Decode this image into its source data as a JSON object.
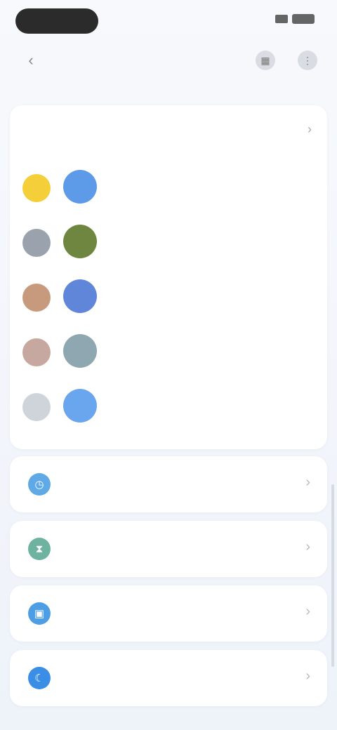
{
  "status_bar": {
    "time": "",
    "signal_icon": "signal-icon",
    "battery_icon": "battery-icon"
  },
  "top_bar": {
    "back_icon": "back-icon",
    "calendar_icon": "calendar-icon",
    "more_icon": "more-icon"
  },
  "app_usage": {
    "title": "",
    "subtitle": "",
    "chevron_icon": "chevron-right-icon",
    "apps": [
      {
        "rank": "",
        "rank_color": "#f4cf3a",
        "icon_color": "#5d9be8",
        "name": "",
        "usage": ""
      },
      {
        "rank": "",
        "rank_color": "#9aa3ad",
        "icon_color": "#6f8640",
        "name": "",
        "usage": ""
      },
      {
        "rank": "",
        "rank_color": "#c79a7d",
        "icon_color": "#5f86d8",
        "name": "",
        "usage": ""
      },
      {
        "rank": "",
        "rank_color": "#c7a8a0",
        "icon_color": "#8fa7b1",
        "name": "",
        "usage": ""
      },
      {
        "rank": "",
        "rank_color": "#cfd4da",
        "icon_color": "#6aa6ee",
        "name": "",
        "usage": ""
      }
    ]
  },
  "settings": [
    {
      "label": "",
      "icon": "clock-icon",
      "color": "#5ea9e6"
    },
    {
      "label": "",
      "icon": "timer-icon",
      "color": "#6fb2a0"
    },
    {
      "label": "",
      "icon": "app-limit-icon",
      "color": "#4e9ee6"
    },
    {
      "label": "",
      "icon": "bedtime-icon",
      "color": "#3a8ee6"
    }
  ]
}
